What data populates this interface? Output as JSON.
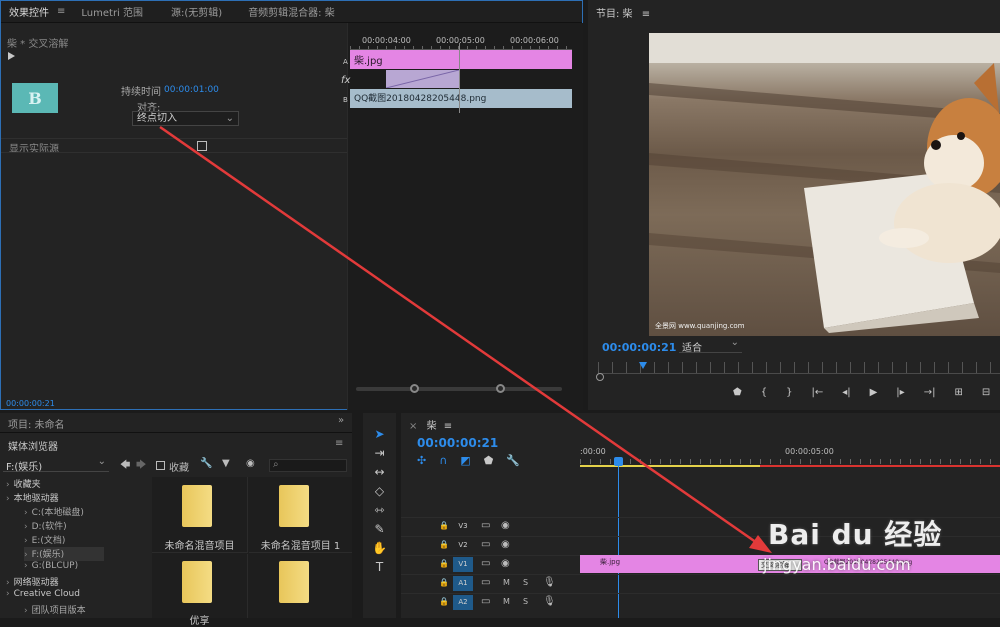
{
  "effects_panel": {
    "tabs": [
      "效果控件",
      "Lumetri 范围",
      "源:(无剪辑)",
      "音频剪辑混合器: 柴"
    ],
    "menu_glyph": "≡",
    "clip_title": "柴 * 交叉溶解",
    "duration_label": "持续时间",
    "duration_value": "00:00:01:00",
    "align_label": "对齐:",
    "align_value": "终点切入",
    "show_source_label": "显示实际源",
    "timecode": "00:00:00:21",
    "ruler": [
      "00:00:04:00",
      "00:00:05:00",
      "00:00:06:00"
    ],
    "track_a": "A",
    "track_b": "B",
    "fx": "fx",
    "clip_a": "柴.jpg",
    "clip_b": "QQ截图20180428205448.png"
  },
  "program_panel": {
    "title": "节目: 柴",
    "timecode": "00:00:00:21",
    "fit": "适合",
    "watermark": "全景网 www.quanjing.com"
  },
  "project_panel": {
    "title": "项目: 未命名",
    "media_browser": "媒体浏览器",
    "drive_select": "F:(娱乐)",
    "favorite_label": "收藏",
    "tree": [
      {
        "label": "收藏夹",
        "indent": 0
      },
      {
        "label": "本地驱动器",
        "indent": 0
      },
      {
        "label": "C:(本地磁盘)",
        "indent": 1
      },
      {
        "label": "D:(软件)",
        "indent": 1
      },
      {
        "label": "E:(文档)",
        "indent": 1
      },
      {
        "label": "F:(娱乐)",
        "indent": 1
      },
      {
        "label": "G:(BLCUP)",
        "indent": 1
      },
      {
        "label": "网络驱动器",
        "indent": 0
      },
      {
        "label": "Creative Cloud",
        "indent": 0
      },
      {
        "label": "团队项目版本",
        "indent": 1
      }
    ],
    "folders": [
      "未命名混音项目",
      "未命名混音项目 1",
      "优享",
      ""
    ]
  },
  "timeline": {
    "title": "柴",
    "timecode": "00:00:00:21",
    "ruler": [
      ":00:00",
      "00:00:05:00"
    ],
    "tracks": [
      {
        "name": "V3",
        "on": false
      },
      {
        "name": "V2",
        "on": false
      },
      {
        "name": "V1",
        "on": true
      },
      {
        "name": "A1",
        "on": true
      },
      {
        "name": "A2",
        "on": true
      }
    ],
    "clip_v1": "柴.jpg",
    "transition": "交叉溶解",
    "clip_v1b": "QQ截图20180428205448.png"
  },
  "overlay": {
    "baidu": "Bai du 经验",
    "url": "jingyan.baidu.com"
  },
  "colors": {
    "accent": "#2d8ceb",
    "clip_pink": "#e485e4",
    "clip_blue": "#a6bccb",
    "arrow": "#e23a3a"
  }
}
